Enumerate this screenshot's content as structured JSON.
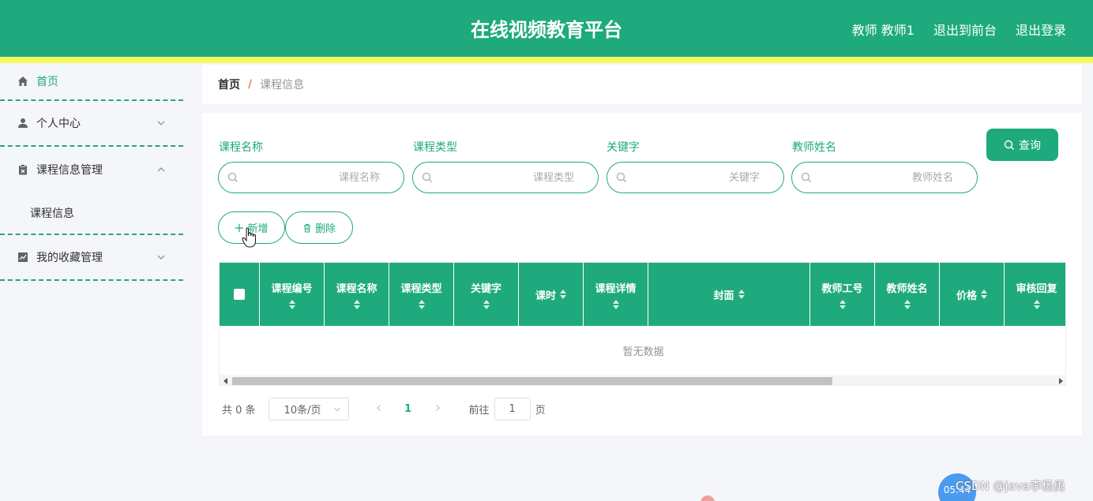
{
  "header": {
    "title": "在线视频教育平台",
    "user": "教师 教师1",
    "to_front": "退出到前台",
    "logout": "退出登录"
  },
  "sidebar": {
    "items": [
      {
        "label": "首页",
        "icon": "home-icon"
      },
      {
        "label": "个人中心",
        "icon": "user-icon",
        "expanded": false
      },
      {
        "label": "课程信息管理",
        "icon": "clipboard-icon",
        "expanded": true,
        "children": [
          {
            "label": "课程信息"
          }
        ]
      },
      {
        "label": "我的收藏管理",
        "icon": "chart-icon",
        "expanded": false
      }
    ]
  },
  "breadcrumb": {
    "home": "首页",
    "separator": "/",
    "current": "课程信息"
  },
  "search": {
    "fields": [
      {
        "label": "课程名称",
        "placeholder": "课程名称",
        "value": ""
      },
      {
        "label": "课程类型",
        "placeholder": "课程类型",
        "value": ""
      },
      {
        "label": "关键字",
        "placeholder": "关键字",
        "value": ""
      },
      {
        "label": "教师姓名",
        "placeholder": "教师姓名",
        "value": ""
      }
    ],
    "query_label": "查询"
  },
  "actions": {
    "add_label": "新增",
    "delete_label": "删除"
  },
  "table": {
    "columns": [
      "课程编号",
      "课程名称",
      "课程类型",
      "关键字",
      "课时",
      "课程详情",
      "封面",
      "教师工号",
      "教师姓名",
      "价格",
      "审核回复"
    ],
    "empty_text": "暂无数据"
  },
  "pagination": {
    "total": "共 0 条",
    "page_size": "10条/页",
    "current_page": "1",
    "goto_prefix": "前往",
    "goto_value": "1",
    "goto_suffix": "页"
  },
  "overlay": {
    "watermark": "CSDN @java李杨勇",
    "timer": "05:44"
  },
  "colors": {
    "primary": "#1eaa7c",
    "header_stripe": "#f4f95e"
  }
}
